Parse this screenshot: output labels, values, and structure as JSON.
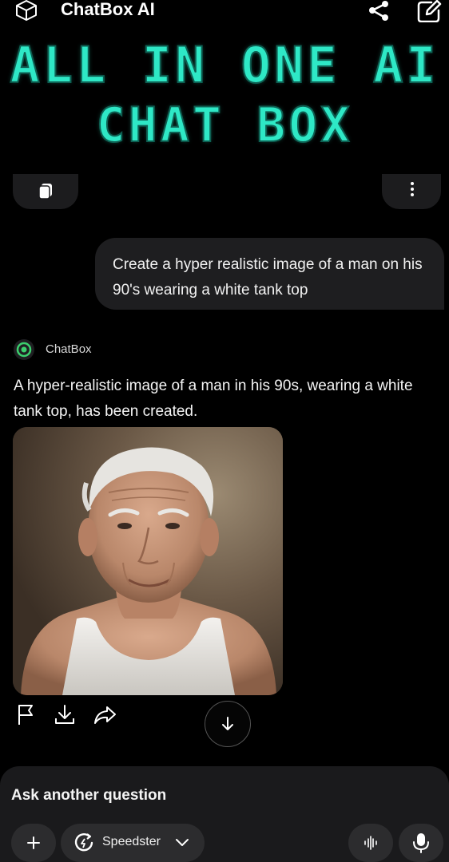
{
  "header": {
    "app_title": "ChatBox AI",
    "logo_icon": "cube-icon",
    "share_icon": "share-icon",
    "edit_icon": "edit-icon"
  },
  "banner": {
    "line1": "ALL IN ONE AI",
    "line2": "CHAT BOX",
    "color": "#2ee8c6"
  },
  "toolbar": {
    "copy_icon": "copy-icon",
    "more_icon": "more-vertical-icon"
  },
  "conversation": {
    "user_message": "Create a hyper realistic image of a man on his 90's wearing a white tank top",
    "bot_name": "ChatBox",
    "bot_message": "A hyper-realistic image of a man in his 90s, wearing a white tank top, has been created.",
    "image_subject": "elderly man in white tank top",
    "action_icons": [
      "flag-icon",
      "download-icon",
      "share-arrow-icon"
    ],
    "scroll_icon": "arrow-down-icon"
  },
  "composer": {
    "prompt_text": "Ask another question",
    "model_label": "Speedster",
    "plus_icon": "plus-icon",
    "voice_icon": "voice-wave-icon",
    "mic_icon": "mic-icon"
  },
  "colors": {
    "background": "#000000",
    "bubble": "#1e1e20",
    "accent_teal": "#2ee8c6",
    "bot_icon_green": "#3ccf6e"
  }
}
